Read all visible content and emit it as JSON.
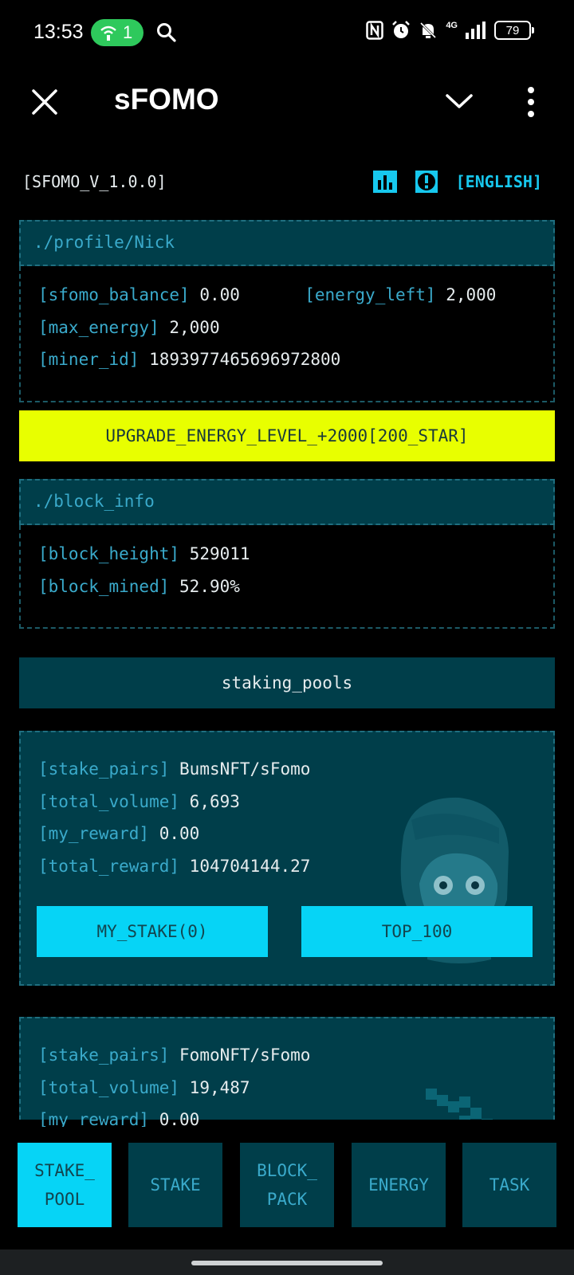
{
  "status_bar": {
    "time": "13:53",
    "hotspot_count": "1",
    "network": "4G",
    "battery": "79"
  },
  "app_bar": {
    "title": "sFOMO",
    "icons": [
      "close-icon",
      "chevron-down-icon",
      "more-vertical-icon"
    ]
  },
  "top_row": {
    "version": "[SFOMO_V_1.0.0]",
    "language": "[ENGLISH]",
    "icons": [
      "bar-chart-icon",
      "info-icon"
    ]
  },
  "profile": {
    "path": "./profile/Nick",
    "balance_key": "[sfomo_balance]",
    "balance_value": "0.00",
    "energy_left_key": "[energy_left]",
    "energy_left_value": "2,000",
    "max_energy_key": "[max_energy]",
    "max_energy_value": "2,000",
    "miner_id_key": "[miner_id]",
    "miner_id_value": "1893977465696972800"
  },
  "upgrade_button": "UPGRADE_ENERGY_LEVEL_+2000[200_STAR]",
  "block_info": {
    "path": "./block_info",
    "height_key": "[block_height]",
    "height_value": "529011",
    "mined_key": "[block_mined]",
    "mined_value": "52.90%"
  },
  "staking_pools": {
    "header": "staking_pools",
    "pools": [
      {
        "pairs_key": "[stake_pairs]",
        "pairs_value": "BumsNFT/sFomo",
        "volume_key": "[total_volume]",
        "volume_value": "6,693",
        "my_reward_key": "[my_reward]",
        "my_reward_value": "0.00",
        "total_reward_key": "[total_reward]",
        "total_reward_value": "104704144.27",
        "my_stake_button": "MY_STAKE(0)",
        "top_button": "TOP_100"
      },
      {
        "pairs_key": "[stake_pairs]",
        "pairs_value": "FomoNFT/sFomo",
        "volume_key": "[total_volume]",
        "volume_value": "19,487",
        "my_reward_key": "[my_reward]",
        "my_reward_value": "0.00"
      }
    ]
  },
  "bottom_nav": {
    "tabs": [
      {
        "label": "STAKE_\nPOOL",
        "active": true
      },
      {
        "label": "STAKE",
        "active": false
      },
      {
        "label": "BLOCK_\nPACK",
        "active": false
      },
      {
        "label": "ENERGY",
        "active": false
      },
      {
        "label": "TASK",
        "active": false
      }
    ]
  },
  "colors": {
    "accent_cyan": "#06d4f6",
    "panel_teal": "#003e4a",
    "key_text": "#3aaacb",
    "upgrade_yellow": "#e8ff00",
    "background": "#000000"
  }
}
